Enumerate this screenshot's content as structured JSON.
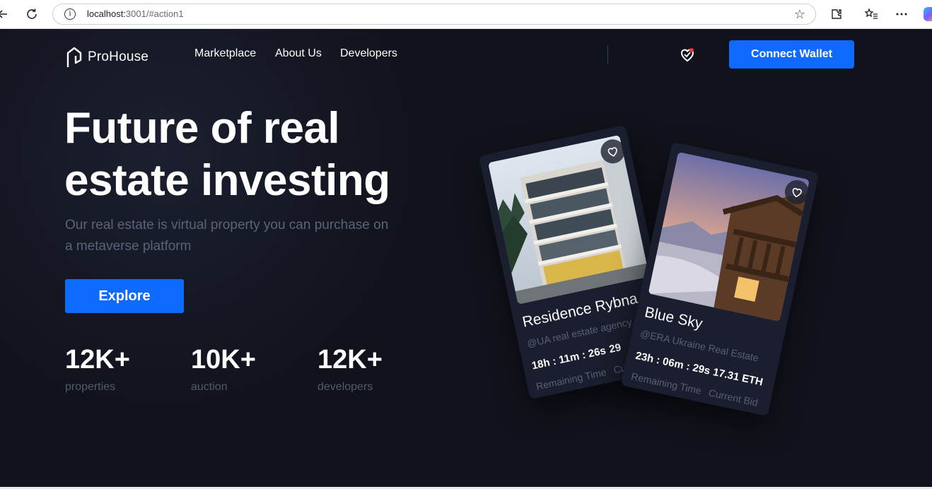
{
  "browser": {
    "url_host": "localhost:",
    "url_rest": "3001/#action1"
  },
  "nav": {
    "logo_text": "ProHouse",
    "links": [
      "Marketplace",
      "About Us",
      "Developers"
    ],
    "connect_label": "Connect Wallet"
  },
  "hero": {
    "title": "Future of real estate investing",
    "subtitle": "Our real estate is virtual property you can purchase on a metaverse platform",
    "explore_label": "Explore",
    "stats": [
      {
        "value": "12K+",
        "label": "properties"
      },
      {
        "value": "10K+",
        "label": "auction"
      },
      {
        "value": "12K+",
        "label": "developers"
      }
    ]
  },
  "cards": [
    {
      "name": "Residence Rybna",
      "agency": "@UA real estate agency",
      "time": "18h : 11m : 26s",
      "time_label": "Remaining Time",
      "bid": "29",
      "bid_label": "Current Bid"
    },
    {
      "name": "Blue Sky",
      "agency": "@ERA Ukraine Real Estate",
      "time": "23h : 06m : 29s",
      "time_label": "Remaining Time",
      "bid": "17.31 ETH",
      "bid_label": "Current Bid"
    }
  ],
  "colors": {
    "accent": "#0f6bff",
    "background": "#11131c",
    "card": "#1a1e2e",
    "muted_text": "#5c6378",
    "notification_dot": "#ff2d2d"
  }
}
